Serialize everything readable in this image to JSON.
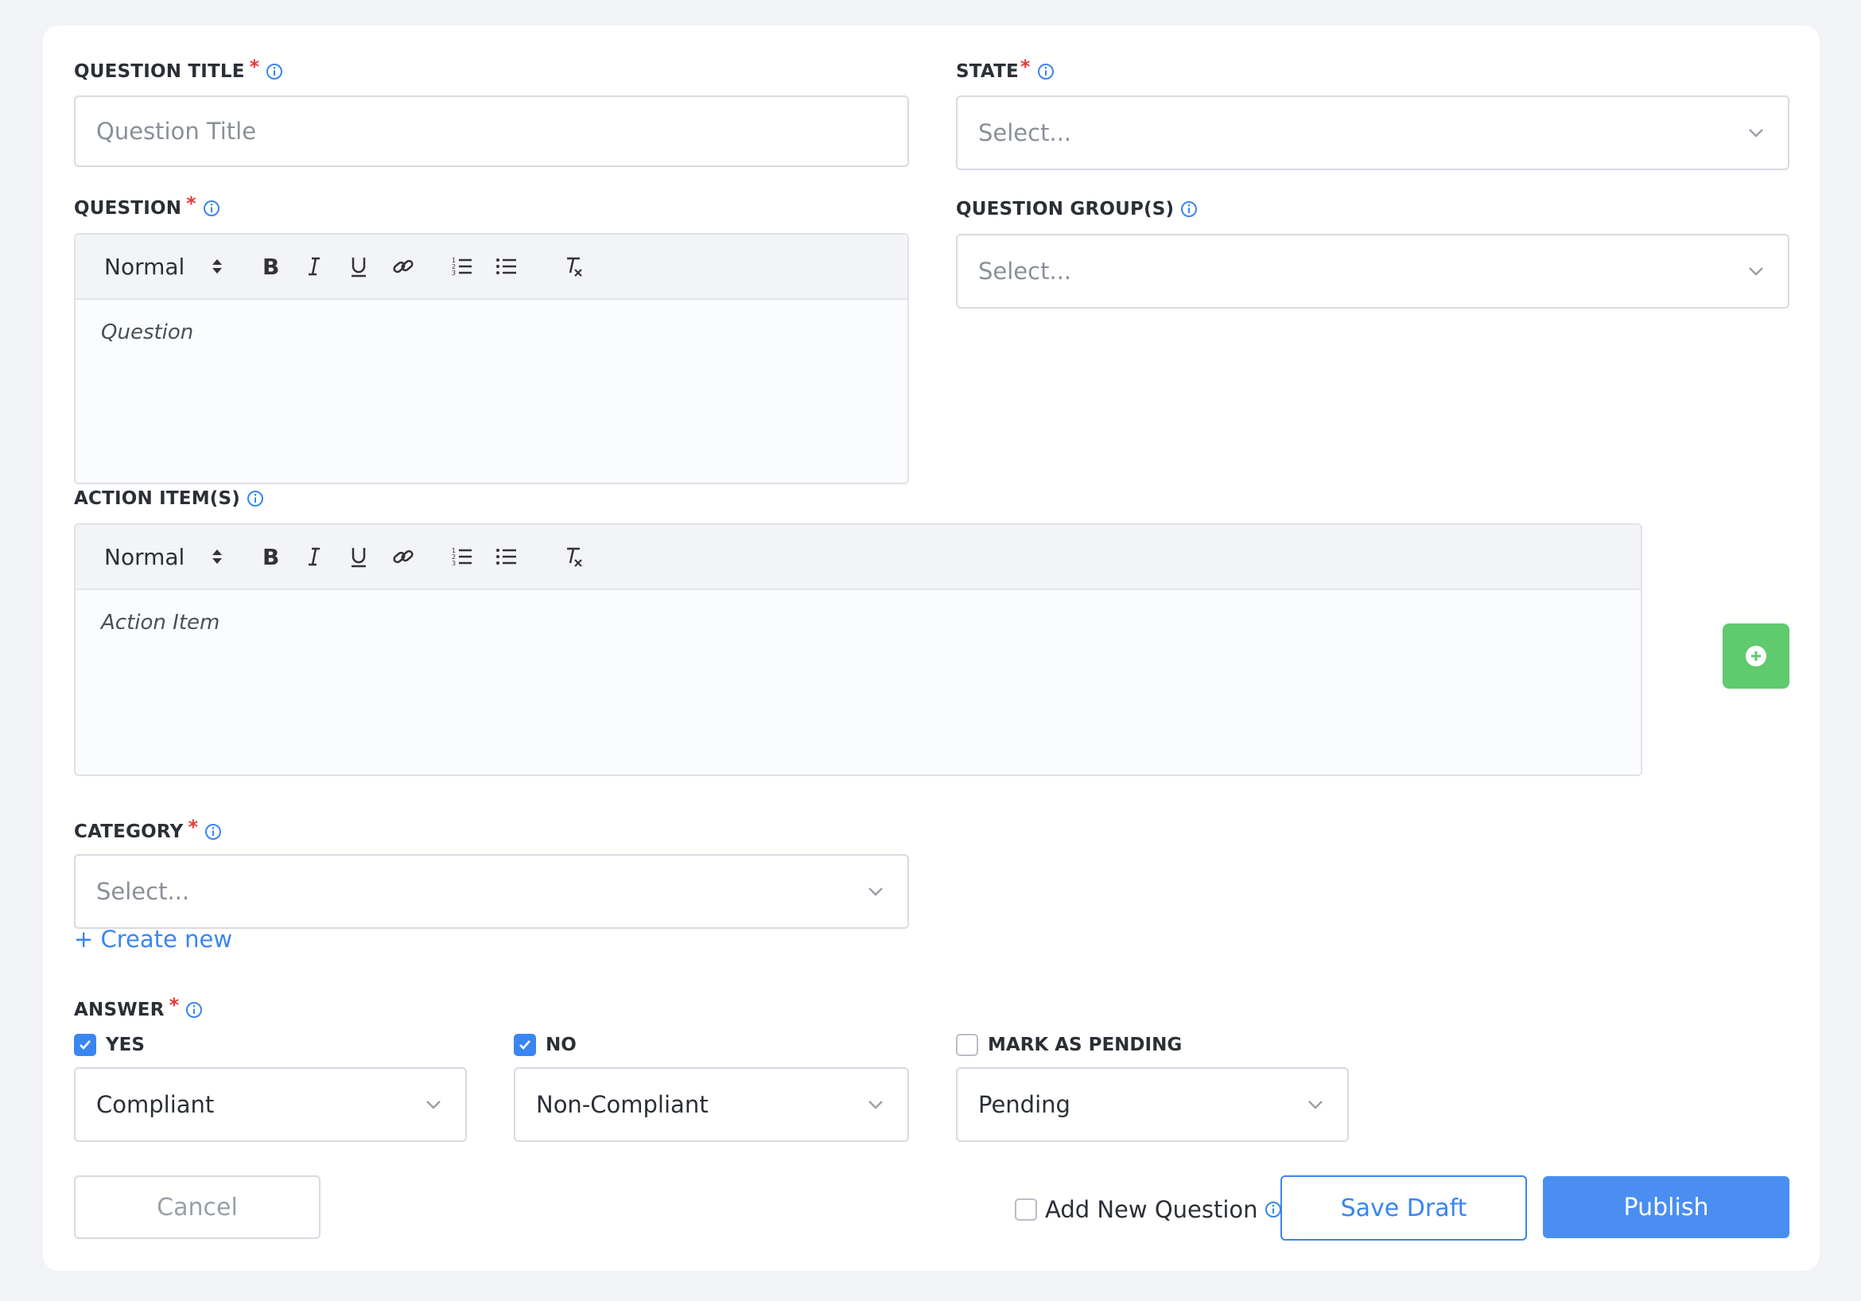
{
  "form": {
    "question_title": {
      "label": "QUESTION TITLE",
      "placeholder": "Question Title"
    },
    "state": {
      "label": "STATE",
      "placeholder": "Select..."
    },
    "question": {
      "label": "QUESTION",
      "format": "Normal",
      "placeholder": "Question"
    },
    "question_groups": {
      "label": "QUESTION GROUP(S)",
      "placeholder": "Select..."
    },
    "action_items": {
      "label": "ACTION ITEM(S)",
      "format": "Normal",
      "placeholder": "Action Item"
    },
    "category": {
      "label": "CATEGORY",
      "placeholder": "Select...",
      "create_new": "+ Create new"
    },
    "answer": {
      "label": "ANSWER",
      "yes": {
        "label": "YES",
        "checked": true,
        "value": "Compliant"
      },
      "no": {
        "label": "NO",
        "checked": true,
        "value": "Non-Compliant"
      },
      "pending": {
        "label": "MARK AS PENDING",
        "checked": false,
        "value": "Pending"
      }
    },
    "required_mark": "*"
  },
  "footer": {
    "cancel": "Cancel",
    "add_new_question": "Add New Question",
    "save_draft": "Save Draft",
    "publish": "Publish"
  },
  "colors": {
    "accent": "#3a85f1",
    "required": "#e5383b",
    "add_button": "#5fca6e",
    "background": "#f1f3f7"
  }
}
